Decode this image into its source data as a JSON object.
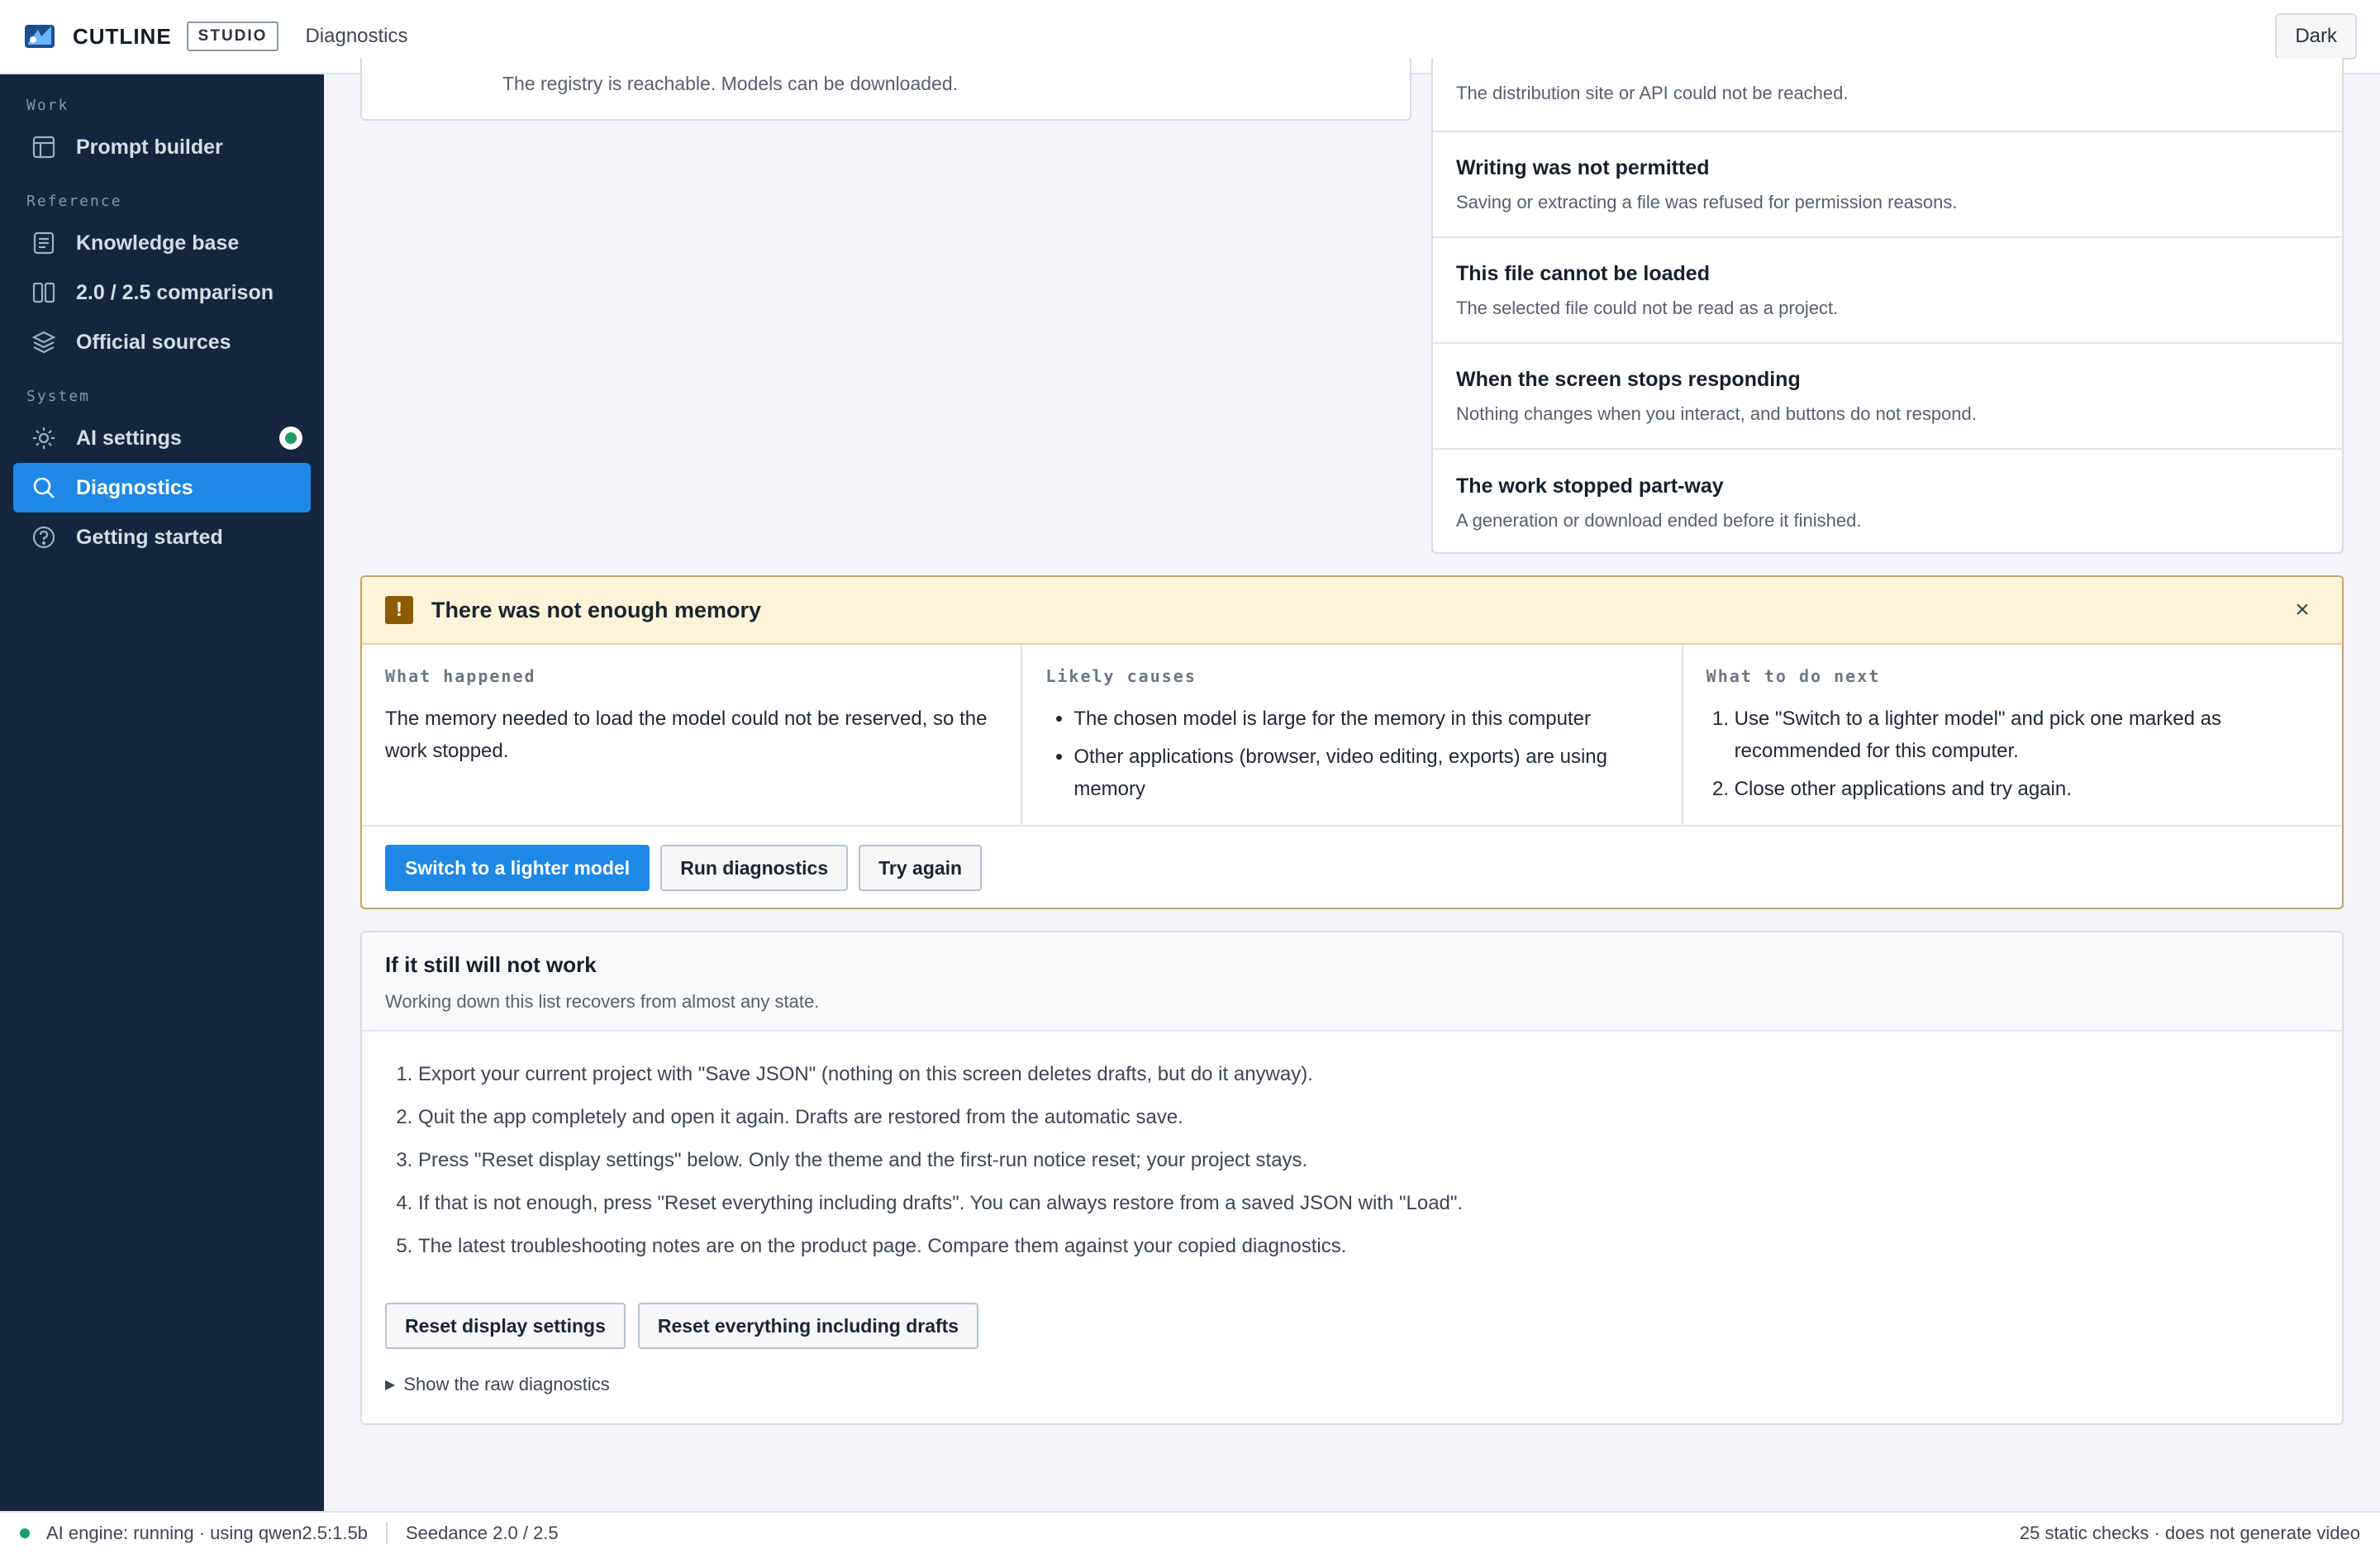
{
  "header": {
    "brand": "CUTLINE",
    "badge": "STUDIO",
    "page": "Diagnostics",
    "theme_button": "Dark"
  },
  "sidebar": {
    "sections": [
      {
        "label": "Work",
        "items": [
          {
            "label": "Prompt builder",
            "icon": "layout-icon"
          }
        ]
      },
      {
        "label": "Reference",
        "items": [
          {
            "label": "Knowledge base",
            "icon": "document-icon"
          },
          {
            "label": "2.0 / 2.5 comparison",
            "icon": "columns-icon"
          },
          {
            "label": "Official sources",
            "icon": "layers-icon"
          }
        ]
      },
      {
        "label": "System",
        "items": [
          {
            "label": "AI settings",
            "icon": "sun-icon"
          },
          {
            "label": "Diagnostics",
            "icon": "search-icon"
          },
          {
            "label": "Getting started",
            "icon": "help-icon"
          }
        ]
      }
    ],
    "active": "Diagnostics"
  },
  "registry_card": {
    "text": "The registry is reachable. Models can be downloaded."
  },
  "issues": [
    {
      "title": "",
      "desc": "The distribution site or API could not be reached."
    },
    {
      "title": "Writing was not permitted",
      "desc": "Saving or extracting a file was refused for permission reasons."
    },
    {
      "title": "This file cannot be loaded",
      "desc": "The selected file could not be read as a project."
    },
    {
      "title": "When the screen stops responding",
      "desc": "Nothing changes when you interact, and buttons do not respond."
    },
    {
      "title": "The work stopped part-way",
      "desc": "A generation or download ended before it finished."
    }
  ],
  "alert": {
    "icon": "!",
    "title": "There was not enough memory",
    "close": "×",
    "what_happened_label": "What happened",
    "what_happened": "The memory needed to load the model could not be reserved, so the work stopped.",
    "causes_label": "Likely causes",
    "causes": [
      "The chosen model is large for the memory in this computer",
      "Other applications (browser, video editing, exports) are using memory"
    ],
    "next_label": "What to do next",
    "next": [
      "Use \"Switch to a lighter model\" and pick one marked as recommended for this computer.",
      "Close other applications and try again."
    ],
    "buttons": {
      "primary": "Switch to a lighter model",
      "diagnostics": "Run diagnostics",
      "retry": "Try again"
    }
  },
  "recover": {
    "title": "If it still will not work",
    "subtitle": "Working down this list recovers from almost any state.",
    "steps": [
      "Export your current project with \"Save JSON\" (nothing on this screen deletes drafts, but do it anyway).",
      "Quit the app completely and open it again. Drafts are restored from the automatic save.",
      "Press \"Reset display settings\" below. Only the theme and the first-run notice reset; your project stays.",
      "If that is not enough, press \"Reset everything including drafts\". You can always restore from a saved JSON with \"Load\".",
      "The latest troubleshooting notes are on the product page. Compare them against your copied diagnostics."
    ],
    "reset_display": "Reset display settings",
    "reset_all": "Reset everything including drafts",
    "raw_toggle": "Show the raw diagnostics"
  },
  "statusbar": {
    "engine": "AI engine: running · using qwen2.5:1.5b",
    "version": "Seedance 2.0 / 2.5",
    "right": "25 static checks · does not generate video"
  },
  "colors": {
    "sidebar_bg": "#13263d",
    "accent": "#1e88e5",
    "warning_bg": "#fdf3d9",
    "warning_icon": "#8c5a00",
    "ok_green": "#1d9b68"
  }
}
